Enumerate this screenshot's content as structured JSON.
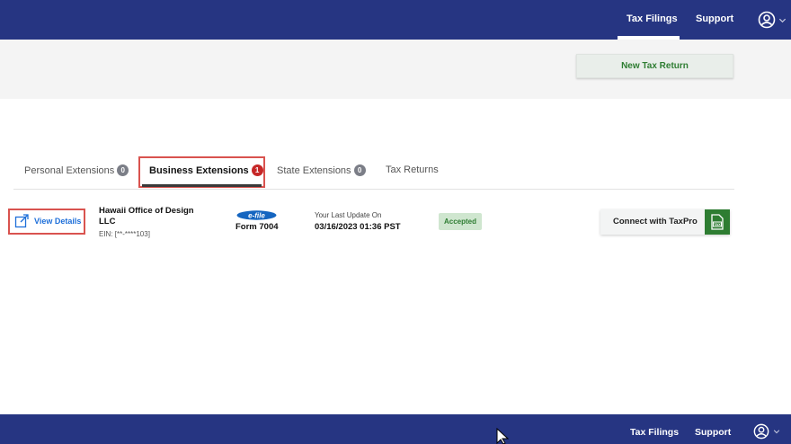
{
  "top_nav": {
    "tax_filings": "Tax Filings",
    "support": "Support",
    "account_icon": "user-circle-icon"
  },
  "actions": {
    "new_tax_return": "New Tax Return"
  },
  "tabs": [
    {
      "label": "Personal Extensions",
      "count": "0",
      "active": false
    },
    {
      "label": "Business Extensions",
      "count": "1",
      "active": true
    },
    {
      "label": "State Extensions",
      "count": "0",
      "active": false
    },
    {
      "label": "Tax Returns",
      "count": "",
      "active": false
    }
  ],
  "filing": {
    "view_details": "View Details",
    "business_name": "Hawaii Office of Design LLC",
    "ein": "EIN: [**-****103]",
    "efile_logo": "e-file",
    "form": "Form 7004",
    "last_update_label": "Your Last Update On",
    "last_update_value": "03/16/2023 01:36 PST",
    "status": "Accepted",
    "connect_label": "Connect with TaxPro",
    "connect_icon": "tax-document-icon",
    "colors": {
      "status_bg": "#cfe6cf",
      "status_fg": "#2e7d32",
      "accent": "#2e7d32"
    }
  },
  "bottom_nav": {
    "tax_filings": "Tax Filings",
    "support": "Support"
  },
  "colors": {
    "nav_bg": "#263582",
    "highlight_border": "#d9534f",
    "link": "#1e6fd9"
  }
}
